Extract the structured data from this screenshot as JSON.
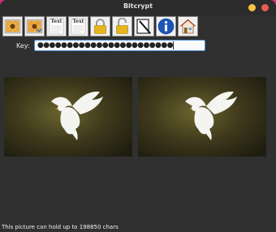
{
  "window": {
    "title": "Bitcrypt"
  },
  "toolbar": {
    "text_label_1": "Text",
    "text_label_2": "Text"
  },
  "key": {
    "label": "Key:",
    "value": "●●●●●●●●●●●●●●●●●●●●●●●"
  },
  "status": {
    "text": "This picture can hold up to 198850 chars"
  },
  "colors": {
    "accent": "#4a90d9",
    "bg": "#303030",
    "titlebar": "#2b2b2b"
  },
  "icons": [
    "open-image-icon",
    "save-image-icon",
    "open-text-icon",
    "save-text-icon",
    "lock-icon",
    "unlock-icon",
    "edit-icon",
    "info-icon",
    "home-icon"
  ]
}
